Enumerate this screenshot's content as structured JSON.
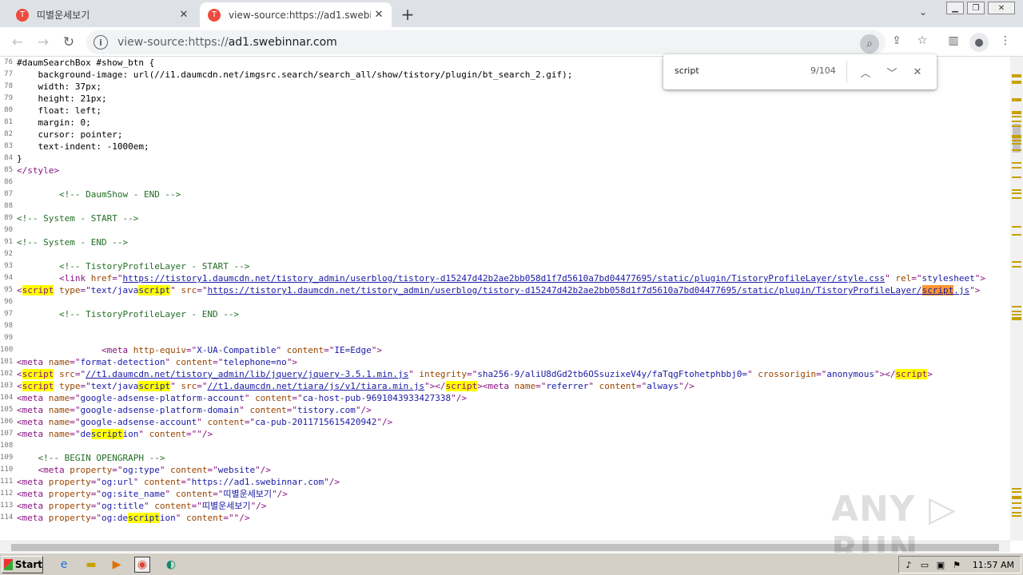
{
  "tabs": [
    {
      "title": "띠별운세보기",
      "favicon": "T",
      "active": false
    },
    {
      "title": "view-source:https://ad1.swebinnar.com",
      "favicon": "T",
      "active": true
    }
  ],
  "address": {
    "scheme": "view-source:https://",
    "host": "ad1.swebinnar.com"
  },
  "findbar": {
    "query": "script",
    "count": "9/104"
  },
  "watermark": "ANY ▷ RUN",
  "taskbar": {
    "start_label": "Start",
    "clock": "11:57 AM"
  },
  "icons": {
    "tab_close": "close-icon",
    "new_tab": "plus-icon",
    "back": "arrow-left-icon",
    "forward": "arrow-right-icon",
    "reload": "reload-icon",
    "info": "info-icon",
    "share": "share-icon",
    "bookmark": "star-icon",
    "sidepanel": "side-panel-icon",
    "profile": "profile-icon",
    "menu": "kebab-menu-icon"
  },
  "source_lines": [
    {
      "n": "76",
      "h": "#daumSearchBox #show_btn {"
    },
    {
      "n": "77",
      "h": "    background-image: url(//i1.daumcdn.net/imgsrc.search/search_all/show/tistory/plugin/bt_search_2.gif);"
    },
    {
      "n": "78",
      "h": "    width: 37px;"
    },
    {
      "n": "79",
      "h": "    height: 21px;"
    },
    {
      "n": "80",
      "h": "    float: left;"
    },
    {
      "n": "81",
      "h": "    margin: 0;"
    },
    {
      "n": "82",
      "h": "    cursor: pointer;"
    },
    {
      "n": "83",
      "h": "    text-indent: -1000em;"
    },
    {
      "n": "84",
      "h": "}"
    },
    {
      "n": "85",
      "h": "<span class=\"tg\">&lt;/style&gt;</span>"
    },
    {
      "n": "86",
      "h": ""
    },
    {
      "n": "87",
      "h": "        <span class=\"cm\">&lt;!-- DaumShow - END --&gt;</span>"
    },
    {
      "n": "88",
      "h": ""
    },
    {
      "n": "89",
      "h": "<span class=\"cm\">&lt;!-- System - START --&gt;</span>"
    },
    {
      "n": "90",
      "h": ""
    },
    {
      "n": "91",
      "h": "<span class=\"cm\">&lt;!-- System - END --&gt;</span>"
    },
    {
      "n": "92",
      "h": ""
    },
    {
      "n": "93",
      "h": "        <span class=\"cm\">&lt;!-- TistoryProfileLayer - START --&gt;</span>"
    },
    {
      "n": "94",
      "h": "        <span class=\"tg\">&lt;link </span><span class=\"an\">href</span><span class=\"tg\">=\"</span><span class=\"ak\">https://tistory1.daumcdn.net/tistory_admin/userblog/tistory-d15247d42b2ae2bb058d1f7d5610a7bd04477695/static/plugin/TistoryProfileLayer/style.css</span><span class=\"tg\">\" </span><span class=\"an\">rel</span><span class=\"tg\">=\"</span><span class=\"av\">stylesheet</span><span class=\"tg\">\"&gt;</span>"
    },
    {
      "n": "95",
      "h": "<span class=\"tg\">&lt;<span class=\"hl\">script</span> </span><span class=\"an\">type</span><span class=\"tg\">=\"</span><span class=\"av\">text/java<span class=\"hl\">script</span></span><span class=\"tg\">\" </span><span class=\"an\">src</span><span class=\"tg\">=\"</span><span class=\"ak\">https://tistory1.daumcdn.net/tistory_admin/userblog/tistory-d15247d42b2ae2bb058d1f7d5610a7bd04477695/static/plugin/TistoryProfileLayer/<span class=\"hl cur\">script</span>.js</span><span class=\"tg\">\"&gt;</span>"
    },
    {
      "n": "96",
      "h": ""
    },
    {
      "n": "97",
      "h": "        <span class=\"cm\">&lt;!-- TistoryProfileLayer - END --&gt;</span>"
    },
    {
      "n": "98",
      "h": ""
    },
    {
      "n": "99",
      "h": ""
    },
    {
      "n": "100",
      "h": "                <span class=\"tg\">&lt;meta </span><span class=\"an\">http-equiv</span><span class=\"tg\">=\"</span><span class=\"av\">X-UA-Compatible</span><span class=\"tg\">\" </span><span class=\"an\">content</span><span class=\"tg\">=\"</span><span class=\"av\">IE=Edge</span><span class=\"tg\">\"&gt;</span>"
    },
    {
      "n": "101",
      "h": "<span class=\"tg\">&lt;meta </span><span class=\"an\">name</span><span class=\"tg\">=\"</span><span class=\"av\">format-detection</span><span class=\"tg\">\" </span><span class=\"an\">content</span><span class=\"tg\">=\"</span><span class=\"av\">telephone=no</span><span class=\"tg\">\"&gt;</span>"
    },
    {
      "n": "102",
      "h": "<span class=\"tg\">&lt;<span class=\"hl\">script</span> </span><span class=\"an\">src</span><span class=\"tg\">=\"</span><span class=\"ak\">//t1.daumcdn.net/tistory_admin/lib/jquery/jquery-3.5.1.min.js</span><span class=\"tg\">\" </span><span class=\"an\">integrity</span><span class=\"tg\">=\"</span><span class=\"av\">sha256-9/aliU8dGd2tb6OSsuzixeV4y/faTqgFtohetphbbj0=</span><span class=\"tg\">\" </span><span class=\"an\">crossorigin</span><span class=\"tg\">=\"</span><span class=\"av\">anonymous</span><span class=\"tg\">\"&gt;&lt;/<span class=\"hl\">script</span>&gt;</span>"
    },
    {
      "n": "103",
      "h": "<span class=\"tg\">&lt;<span class=\"hl\">script</span> </span><span class=\"an\">type</span><span class=\"tg\">=\"</span><span class=\"av\">text/java<span class=\"hl\">script</span></span><span class=\"tg\">\" </span><span class=\"an\">src</span><span class=\"tg\">=\"</span><span class=\"ak\">//t1.daumcdn.net/tiara/js/v1/tiara.min.js</span><span class=\"tg\">\"&gt;&lt;/<span class=\"hl\">script</span>&gt;&lt;meta </span><span class=\"an\">name</span><span class=\"tg\">=\"</span><span class=\"av\">referrer</span><span class=\"tg\">\" </span><span class=\"an\">content</span><span class=\"tg\">=\"</span><span class=\"av\">always</span><span class=\"tg\">\"/&gt;</span>"
    },
    {
      "n": "104",
      "h": "<span class=\"tg\">&lt;meta </span><span class=\"an\">name</span><span class=\"tg\">=\"</span><span class=\"av\">google-adsense-platform-account</span><span class=\"tg\">\" </span><span class=\"an\">content</span><span class=\"tg\">=\"</span><span class=\"av\">ca-host-pub-9691043933427338</span><span class=\"tg\">\"/&gt;</span>"
    },
    {
      "n": "105",
      "h": "<span class=\"tg\">&lt;meta </span><span class=\"an\">name</span><span class=\"tg\">=\"</span><span class=\"av\">google-adsense-platform-domain</span><span class=\"tg\">\" </span><span class=\"an\">content</span><span class=\"tg\">=\"</span><span class=\"av\">tistory.com</span><span class=\"tg\">\"/&gt;</span>"
    },
    {
      "n": "106",
      "h": "<span class=\"tg\">&lt;meta </span><span class=\"an\">name</span><span class=\"tg\">=\"</span><span class=\"av\">google-adsense-account</span><span class=\"tg\">\" </span><span class=\"an\">content</span><span class=\"tg\">=\"</span><span class=\"av\">ca-pub-2011715615420942</span><span class=\"tg\">\"/&gt;</span>"
    },
    {
      "n": "107",
      "h": "<span class=\"tg\">&lt;meta </span><span class=\"an\">name</span><span class=\"tg\">=\"</span><span class=\"av\">de<span class=\"hl\">script</span>ion</span><span class=\"tg\">\" </span><span class=\"an\">content</span><span class=\"tg\">=\"\"/&gt;</span>"
    },
    {
      "n": "108",
      "h": ""
    },
    {
      "n": "109",
      "h": "    <span class=\"cm\">&lt;!-- BEGIN OPENGRAPH --&gt;</span>"
    },
    {
      "n": "110",
      "h": "    <span class=\"tg\">&lt;meta </span><span class=\"an\">property</span><span class=\"tg\">=\"</span><span class=\"av\">og:type</span><span class=\"tg\">\" </span><span class=\"an\">content</span><span class=\"tg\">=\"</span><span class=\"av\">website</span><span class=\"tg\">\"/&gt;</span>"
    },
    {
      "n": "111",
      "h": "<span class=\"tg\">&lt;meta </span><span class=\"an\">property</span><span class=\"tg\">=\"</span><span class=\"av\">og:url</span><span class=\"tg\">\" </span><span class=\"an\">content</span><span class=\"tg\">=\"</span><span class=\"av\">https://ad1.swebinnar.com</span><span class=\"tg\">\"/&gt;</span>"
    },
    {
      "n": "112",
      "h": "<span class=\"tg\">&lt;meta </span><span class=\"an\">property</span><span class=\"tg\">=\"</span><span class=\"av\">og:site_name</span><span class=\"tg\">\" </span><span class=\"an\">content</span><span class=\"tg\">=\"</span><span class=\"av\">띠별운세보기</span><span class=\"tg\">\"/&gt;</span>"
    },
    {
      "n": "113",
      "h": "<span class=\"tg\">&lt;meta </span><span class=\"an\">property</span><span class=\"tg\">=\"</span><span class=\"av\">og:title</span><span class=\"tg\">\" </span><span class=\"an\">content</span><span class=\"tg\">=\"</span><span class=\"av\">띠별운세보기</span><span class=\"tg\">\"/&gt;</span>"
    },
    {
      "n": "114",
      "h": "<span class=\"tg\">&lt;meta </span><span class=\"an\">property</span><span class=\"tg\">=\"</span><span class=\"av\">og:de<span class=\"hl\">script</span>ion</span><span class=\"tg\">\" </span><span class=\"an\">content</span><span class=\"tg\">=\"\"/&gt;</span>"
    }
  ]
}
